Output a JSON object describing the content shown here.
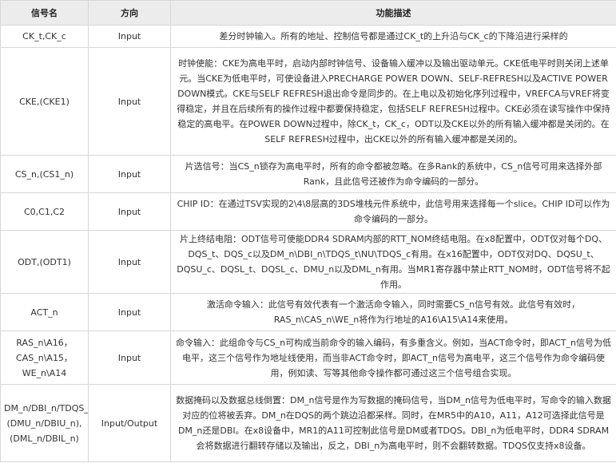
{
  "headers": [
    "信号名",
    "方向",
    "功能描述"
  ],
  "rows": [
    {
      "name": "CK_t,CK_c",
      "dir": "Input",
      "desc": "差分时钟输入。所有的地址、控制信号都是通过CK_t的上升沿与CK_c的下降沿进行采样的"
    },
    {
      "name": "CKE,(CKE1)",
      "dir": "Input",
      "desc": "时钟使能：CKE为高电平时，启动内部时钟信号、设备输入缓冲以及输出驱动单元。CKE低电平时则关闭上述单元。当CKE为低电平时，可使设备进入PRECHARGE POWER DOWN、SELF-REFRESH以及ACTIVE POWER DOWN模式。CKE与SELF REFRESH退出命令是同步的。在上电以及初始化序列过程中，VREFCA与VREF将变得稳定，并且在后续所有的操作过程中都要保持稳定，包括SELF REFRESH过程中。CKE必须在读写操作中保持稳定的高电平。在POWER DOWN过程中，除CK_t，CK_c，ODT以及CKE以外的所有输入缓冲都是关闭的。在SELF REFRESH过程中，出CKE以外的所有输入缓冲都是关闭的。"
    },
    {
      "name": "CS_n,(CS1_n)",
      "dir": "Input",
      "desc": "片选信号：当CS_n锁存为高电平时，所有的命令都被忽略。在多Rank的系统中，CS_n信号可用来选择外部Rank，且此信号还被作为命令编码的一部分。"
    },
    {
      "name": "C0,C1,C2",
      "dir": "Input",
      "desc": "CHIP ID：在通过TSV实现的2\\4\\8层高的3DS堆栈元件系统中，此信号用来选择每一个slice。CHIP ID可以作为命令编码的一部分。"
    },
    {
      "name": "ODT,(ODT1)",
      "dir": "Input",
      "desc": "片上终结电阻：ODT信号可使能DDR4 SDRAM内部的RTT_NOM终结电阻。在x8配置中，ODT仅对每个DQ、DQS_t、DQS_c以及DM_n\\DBI_n\\TDQS_t\\NU\\TDQS_c有用。在x16配置中，ODT仅对DQ、DQSU_t、DQSU_c、DQSL_t、DQSL_c、DMU_n以及DML_n有用。当MR1寄存器中禁止RTT_NOM时，ODT信号将不起作用。"
    },
    {
      "name": "ACT_n",
      "dir": "Input",
      "desc": "激活命令输入：此信号有效代表有一个激活命令输入，同时需要CS_n信号有效。此信号有效时，RAS_n\\CAS_n\\WE_n将作为行地址的A16\\A15\\A14来使用。"
    },
    {
      "name": "RAS_n\\A16，CAS_n\\A15，WE_n\\A14",
      "dir": "Input",
      "desc": "命令输入：此组命令与CS_n可构成当前命令的输入编码，有多重含义。例如，当ACT命令时，即ACT_n信号为低电平，这三个信号作为地址线使用，而当非ACT命令时，即ACT_n信号为高电平，这三个信号作为命令编码使用，例如读、写等其他命令操作都可通过这三个信号组合实现。"
    },
    {
      "name": "DM_n/DBI_n/TDQS_t,(DMU_n/DBIU_n),(DML_n/DBIL_n)",
      "dir": "Input/Output",
      "desc": "数据掩码以及数据总线倒置：DM_n信号是作为写数据的掩码信号，当DM_n信号为低电平时，写命令的输入数据对应的位将被丢弃。DM_n在DQS的两个跳边沿都采样。同时，在MR5中的A10，A11，A12可选择此信号是DM_n还是DBI。在x8设备中，MR1的A11可控制此信号是DM或者TDQS。DBI_n为低电平时，DDR4 SDRAM会将数据进行翻转存储以及输出，反之，DBI_n为高电平时，则不会翻转数据。TDQS仅支持x8设备。"
    }
  ]
}
